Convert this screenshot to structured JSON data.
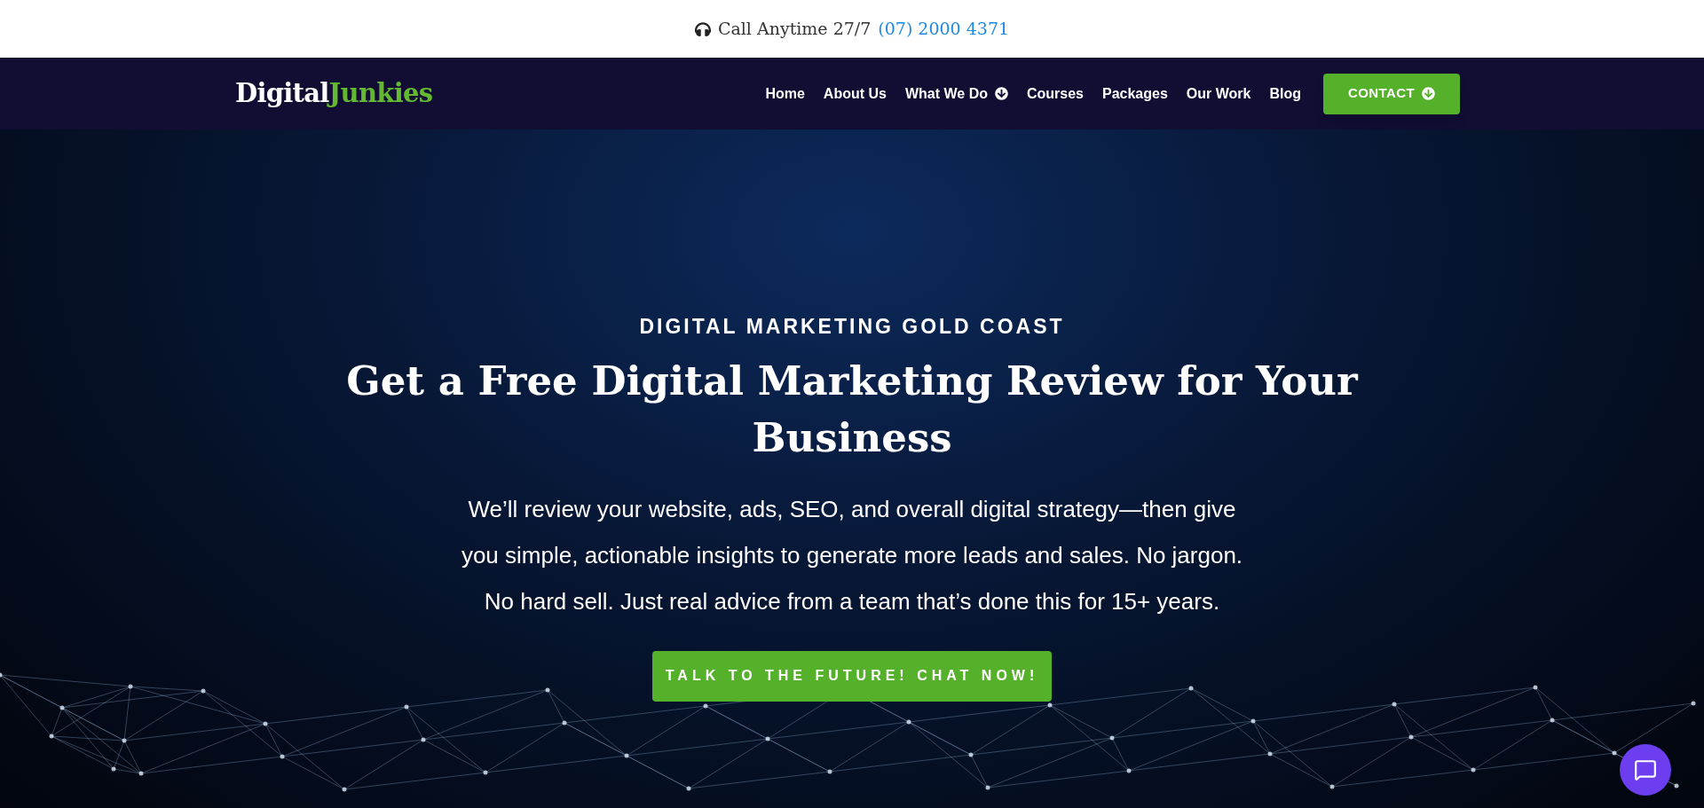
{
  "top_bar": {
    "label": "Call Anytime 27/7",
    "phone": "(07) 2000 4371"
  },
  "logo": {
    "first": "Digital",
    "second": "Junkies"
  },
  "nav": [
    {
      "label": "Home",
      "dropdown": false
    },
    {
      "label": "About Us",
      "dropdown": false
    },
    {
      "label": "What We Do",
      "dropdown": true
    },
    {
      "label": "Courses",
      "dropdown": false
    },
    {
      "label": "Packages",
      "dropdown": false
    },
    {
      "label": "Our Work",
      "dropdown": false
    },
    {
      "label": "Blog",
      "dropdown": false
    }
  ],
  "contact_button": {
    "label": "CONTACT"
  },
  "hero": {
    "eyebrow": "DIGITAL MARKETING GOLD COAST",
    "title": "Get a Free Digital Marketing Review for Your Business",
    "text": "We’ll review your website, ads, SEO, and overall digital strategy—then give you simple, actionable insights to generate more leads and sales. No jargon. No hard sell. Just real advice from a team that’s done this for 15+ years.",
    "cta": "TALK TO THE FUTURE! CHAT NOW!"
  }
}
